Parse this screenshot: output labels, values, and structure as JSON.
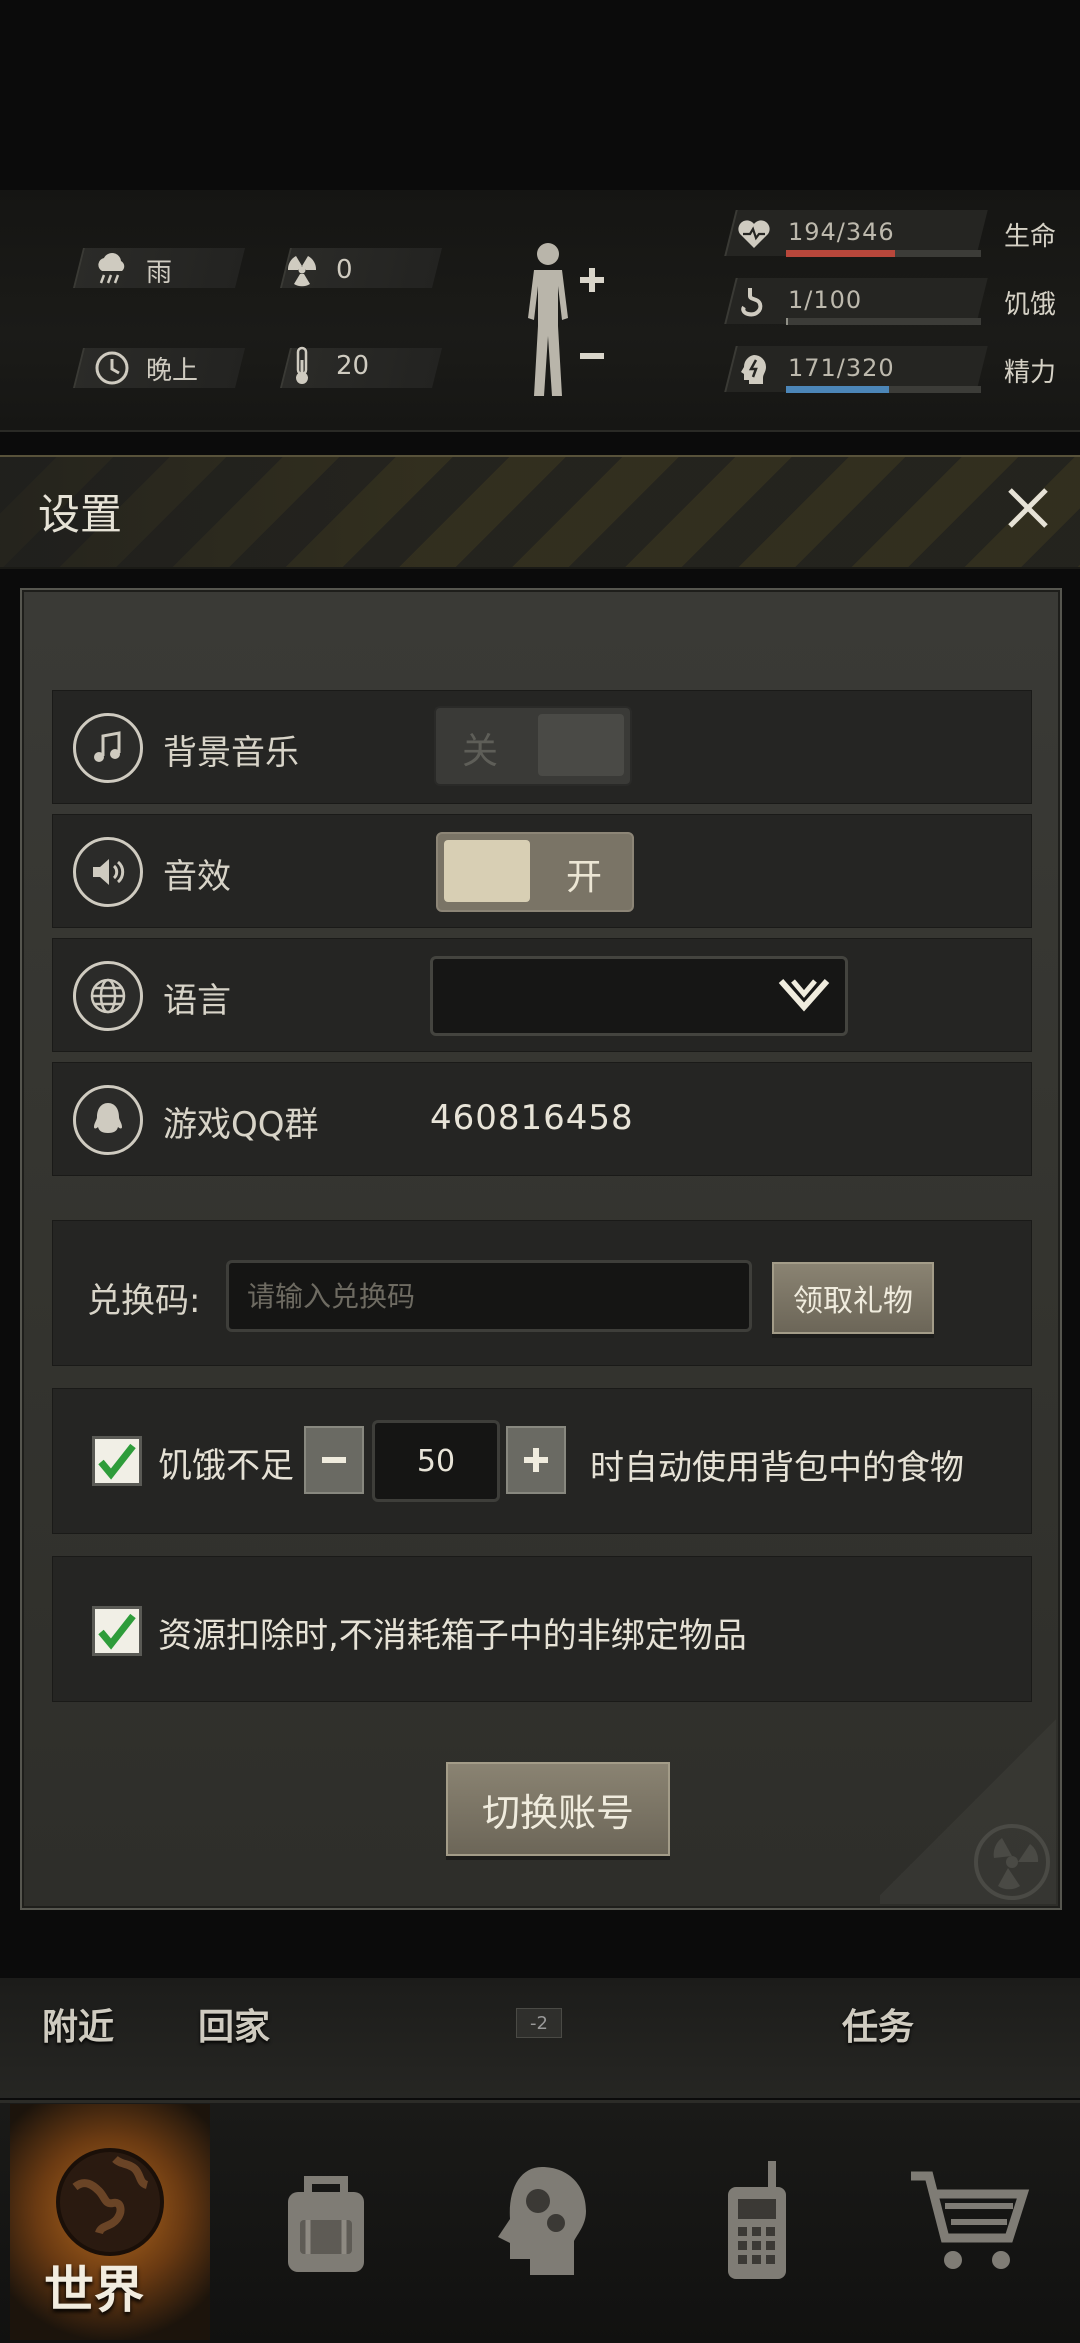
{
  "status": {
    "weather": "雨",
    "radiation": "0",
    "time_of_day": "晚上",
    "temperature": "20"
  },
  "vitals": [
    {
      "value": "194/346",
      "label": "生命",
      "fraction": 0.56,
      "color": "#b8473b"
    },
    {
      "value": "1/100",
      "label": "饥饿",
      "fraction": 0.01,
      "color": "#8f8f86"
    },
    {
      "value": "171/320",
      "label": "精力",
      "fraction": 0.53,
      "color": "#4c86b8"
    }
  ],
  "modal": {
    "title": "设置",
    "bgm": {
      "label": "背景音乐",
      "state": "关"
    },
    "sfx": {
      "label": "音效",
      "state": "开"
    },
    "language": {
      "label": "语言",
      "value": ""
    },
    "qq": {
      "label": "游戏QQ群",
      "number": "460816458"
    },
    "redeem": {
      "label": "兑换码:",
      "placeholder": "请输入兑换码",
      "button": "领取礼物"
    },
    "hunger": {
      "prefix": "饥饿不足",
      "value": "50",
      "suffix": "时自动使用背包中的食物"
    },
    "resource": {
      "label": "资源扣除时,不消耗箱子中的非绑定物品"
    },
    "switch_account": "切换账号"
  },
  "sub_nav": {
    "nearby": "附近",
    "home": "回家",
    "badge": "-2",
    "task": "任务"
  },
  "bottom_nav": {
    "world": "世界"
  }
}
